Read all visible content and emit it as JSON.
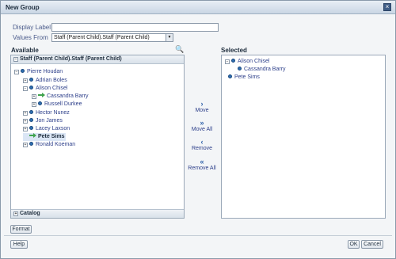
{
  "dialog": {
    "title": "New Group"
  },
  "form": {
    "display_label": "Display Label",
    "display_value": "",
    "values_from_label": "Values From",
    "values_from_selected": "Staff (Parent Child).Staff (Parent Child)"
  },
  "available": {
    "heading": "Available",
    "panel_title": "Staff (Parent Child).Staff (Parent Child)",
    "tree": [
      {
        "label": "Pierre Houdan"
      },
      {
        "label": "Adrian Boles"
      },
      {
        "label": "Alison Chisel"
      },
      {
        "label": "Cassandra Barry"
      },
      {
        "label": "Russell Durkee"
      },
      {
        "label": "Hector Nunez"
      },
      {
        "label": "Jon James"
      },
      {
        "label": "Lacey Laxson"
      },
      {
        "label": "Pete Sims"
      },
      {
        "label": "Ronald Koeman"
      }
    ],
    "catalog_label": "Catalog"
  },
  "shuttle": {
    "move": "Move",
    "move_all": "Move All",
    "remove": "Remove",
    "remove_all": "Remove All"
  },
  "selected": {
    "heading": "Selected",
    "tree": [
      {
        "label": "Alison Chisel"
      },
      {
        "label": "Cassandra Barry"
      },
      {
        "label": "Pete Sims"
      }
    ]
  },
  "buttons": {
    "format": "Format",
    "help": "Help",
    "ok": "OK",
    "cancel": "Cancel"
  },
  "icons": {
    "close": "close-icon",
    "search": "binoculars-icon",
    "node": "member-dot-icon",
    "moved": "moved-arrow-icon"
  },
  "colors": {
    "accent": "#2f6fb1",
    "moved": "#3fa34d",
    "label": "#4a5a8a"
  }
}
